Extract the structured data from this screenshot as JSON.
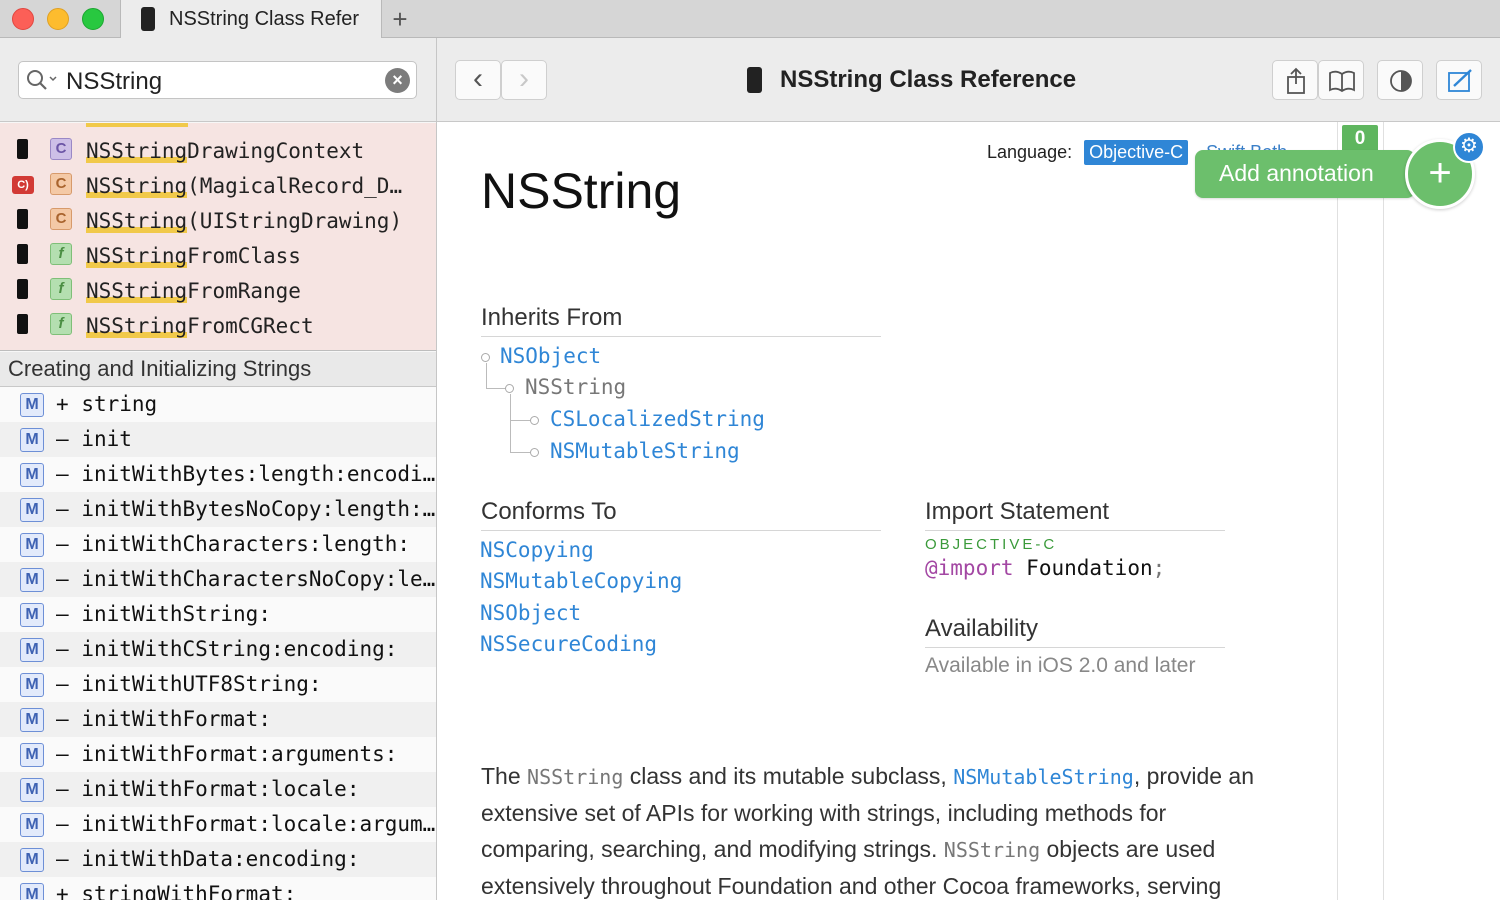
{
  "window": {
    "tab_title": "NSString Class Refer",
    "new_tab_symbol": "+"
  },
  "sidebar": {
    "search": {
      "value": "NSString",
      "clear_symbol": "×"
    },
    "results": [
      {
        "platform": "ios",
        "kind": "C",
        "kind_type": "class",
        "highlight": "NSString",
        "rest": "DrawingContext"
      },
      {
        "platform": "c",
        "kind": "C",
        "kind_type": "category",
        "highlight": "NSString",
        "rest": "(MagicalRecord_D…"
      },
      {
        "platform": "ios",
        "kind": "C",
        "kind_type": "category",
        "highlight": "NSString",
        "rest": "(UIStringDrawing)"
      },
      {
        "platform": "ios",
        "kind": "f",
        "kind_type": "function",
        "highlight": "NSString",
        "rest": "FromClass"
      },
      {
        "platform": "ios",
        "kind": "f",
        "kind_type": "function",
        "highlight": "NSString",
        "rest": "FromRange"
      },
      {
        "platform": "ios",
        "kind": "f",
        "kind_type": "function",
        "highlight": "NSString",
        "rest": "FromCGRect"
      }
    ],
    "section_header": "Creating and Initializing Strings",
    "methods": [
      {
        "badge": "M",
        "prefix": "+",
        "name": "string"
      },
      {
        "badge": "M",
        "prefix": "–",
        "name": "init"
      },
      {
        "badge": "M",
        "prefix": "–",
        "name": "initWithBytes:length:encodi…"
      },
      {
        "badge": "M",
        "prefix": "–",
        "name": "initWithBytesNoCopy:length:…"
      },
      {
        "badge": "M",
        "prefix": "–",
        "name": "initWithCharacters:length:"
      },
      {
        "badge": "M",
        "prefix": "–",
        "name": "initWithCharactersNoCopy:le…"
      },
      {
        "badge": "M",
        "prefix": "–",
        "name": "initWithString:"
      },
      {
        "badge": "M",
        "prefix": "–",
        "name": "initWithCString:encoding:"
      },
      {
        "badge": "M",
        "prefix": "–",
        "name": "initWithUTF8String:"
      },
      {
        "badge": "M",
        "prefix": "–",
        "name": "initWithFormat:"
      },
      {
        "badge": "M",
        "prefix": "–",
        "name": "initWithFormat:arguments:"
      },
      {
        "badge": "M",
        "prefix": "–",
        "name": "initWithFormat:locale:"
      },
      {
        "badge": "M",
        "prefix": "–",
        "name": "initWithFormat:locale:argum…"
      },
      {
        "badge": "M",
        "prefix": "–",
        "name": "initWithData:encoding:"
      },
      {
        "badge": "M",
        "prefix": "+",
        "name": "stringWithFormat:"
      }
    ]
  },
  "toolbar": {
    "back_symbol": "‹",
    "forward_symbol": "›",
    "title": "NSString Class Reference"
  },
  "doc": {
    "language_label": "Language:",
    "language_selected": "Objective-C",
    "language_other": "Swift   Both",
    "annotation_count": "0",
    "add_annotation": "Add annotation",
    "add_symbol": "+",
    "gear_symbol": "⚙",
    "title": "NSString",
    "inherits_from_title": "Inherits From",
    "inheritance": {
      "root": "NSObject",
      "self": "NSString",
      "children": [
        "CSLocalizedString",
        "NSMutableString"
      ]
    },
    "conforms_to_title": "Conforms To",
    "conforms_to": [
      "NSCopying",
      "NSMutableCopying",
      "NSObject",
      "NSSecureCoding"
    ],
    "import_title": "Import Statement",
    "import_language": "OBJECTIVE-C",
    "import_keyword": "@import",
    "import_module": "Foundation",
    "import_semicolon": ";",
    "availability_title": "Availability",
    "availability_text": "Available in iOS 2.0 and later",
    "overview": {
      "p1": "The ",
      "c1": "NSString",
      "p2": " class and its mutable subclass, ",
      "c2": "NSMutableString",
      "p3": ", provide an extensive set of APIs for working with strings, including methods for comparing, searching, and modifying strings. ",
      "c3": "NSString",
      "p4": " objects are used extensively throughout Foundation and other Cocoa frameworks, serving"
    }
  }
}
